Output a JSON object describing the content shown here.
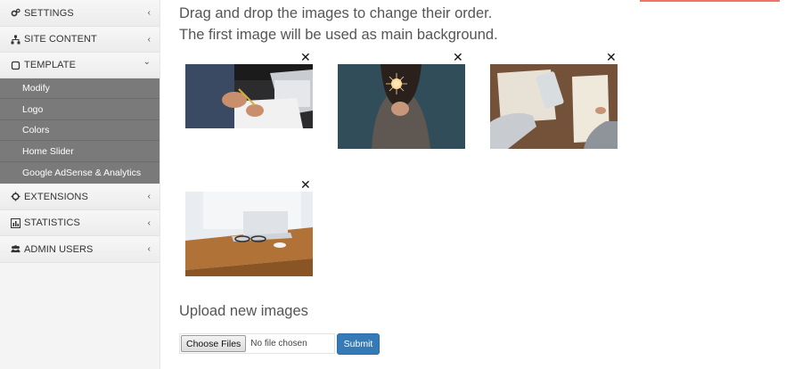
{
  "sidebar": {
    "items": [
      {
        "label": "SETTINGS",
        "icon": "cogs-icon",
        "chevron": "‹"
      },
      {
        "label": "SITE CONTENT",
        "icon": "sitemap-icon",
        "chevron": "‹"
      },
      {
        "label": "TEMPLATE",
        "icon": "square-icon",
        "chevron": "⌄"
      },
      {
        "label": "EXTENSIONS",
        "icon": "puzzle-icon",
        "chevron": "‹"
      },
      {
        "label": "STATISTICS",
        "icon": "bar-chart-icon",
        "chevron": "‹"
      },
      {
        "label": "ADMIN USERS",
        "icon": "users-icon",
        "chevron": "‹"
      }
    ],
    "template_submenu": [
      "Modify",
      "Logo",
      "Colors",
      "Home Slider",
      "Google AdSense & Analytics"
    ]
  },
  "main": {
    "instructions": [
      "Drag and drop the images to change their order.",
      "The first image will be used as main background."
    ],
    "images": [
      {
        "name": "person-writing-notebook",
        "remove_label": "✕"
      },
      {
        "name": "woman-holding-sparkler",
        "remove_label": "✕"
      },
      {
        "name": "phone-and-notebook-on-desk",
        "remove_label": "✕"
      },
      {
        "name": "laptop-and-glasses-on-wooden-desk",
        "remove_label": "✕"
      }
    ],
    "upload": {
      "title": "Upload new images",
      "choose_label": "Choose Files",
      "file_status": "No file chosen",
      "submit_label": "Submit"
    }
  },
  "colors": {
    "accent": "#f27468",
    "primary_button": "#337ab7",
    "submenu_bg": "#7a7a7a"
  }
}
